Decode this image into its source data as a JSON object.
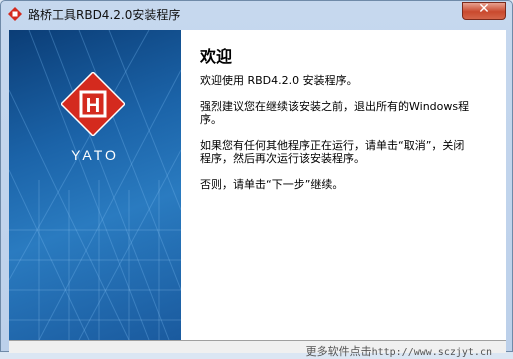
{
  "window": {
    "title": "路桥工具RBD4.2.0安装程序",
    "close_glyph": "✕"
  },
  "banner": {
    "logo_text": "YATO",
    "logo_glyph": "H"
  },
  "content": {
    "heading": "欢迎",
    "line1": "欢迎使用 RBD4.2.0 安装程序。",
    "line2a": "强烈建议您在继续该安装之前，退出所有的Windows程",
    "line2b": "序。",
    "line3a": "如果您有任何其他程序正在运行，请单击“取消”，关闭",
    "line3b": "程序，然后再次运行该安装程序。",
    "line4": "否则，请单击“下一步”继续。"
  },
  "footer": {
    "watermark_label": "更多软件点击",
    "watermark_url": "http://www.sczjyt.cn"
  },
  "colors": {
    "logo_red": "#d42a1e",
    "banner_blue": "#1b63a8"
  }
}
